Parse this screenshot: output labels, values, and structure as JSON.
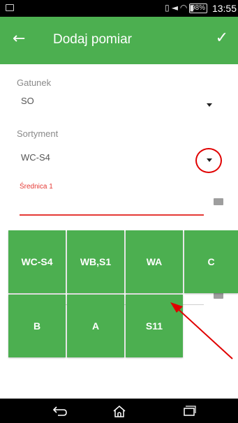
{
  "status_bar": {
    "icons": [
      "vibrate-icon",
      "mute-icon",
      "wifi-icon",
      "signal-icon"
    ],
    "battery": "98%",
    "time": "13:55"
  },
  "app_bar": {
    "title": "Dodaj pomiar",
    "back_icon": "arrow-back-icon",
    "confirm_icon": "check-icon",
    "color": "#4caf50"
  },
  "form": {
    "gatunek": {
      "label": "Gatunek",
      "value": "SO"
    },
    "sortyment": {
      "label": "Sortyment",
      "value": "WC-S4"
    },
    "srednica": {
      "label": "Średnica 1",
      "value": ""
    }
  },
  "options": [
    {
      "label": "WC-S4"
    },
    {
      "label": "WB,S1"
    },
    {
      "label": "WA"
    },
    {
      "label": "C"
    },
    {
      "label": "B"
    },
    {
      "label": "A"
    },
    {
      "label": "S11"
    }
  ],
  "annotation_colors": {
    "circle": "#e00000",
    "arrow": "#e00000",
    "accent": "#4caf50",
    "error": "#e53935"
  }
}
